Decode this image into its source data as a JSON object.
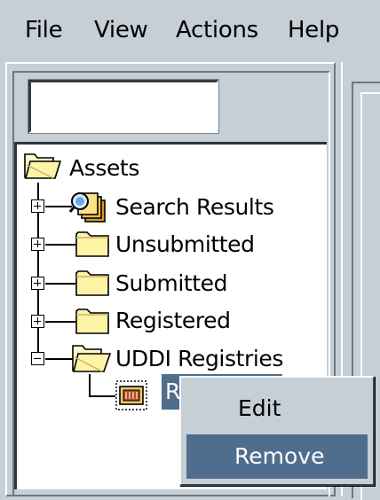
{
  "menubar": {
    "items": [
      "File",
      "View",
      "Actions",
      "Help"
    ]
  },
  "search": {
    "value": "",
    "placeholder": ""
  },
  "tree": {
    "root": {
      "label": "Assets",
      "icon": "open-folder-icon"
    },
    "children": [
      {
        "label": "Search Results",
        "icon": "search-results-icon",
        "expander": "plus"
      },
      {
        "label": "Unsubmitted",
        "icon": "folder-icon",
        "expander": "plus"
      },
      {
        "label": "Submitted",
        "icon": "folder-icon",
        "expander": "plus"
      },
      {
        "label": "Registered",
        "icon": "folder-icon",
        "expander": "plus"
      },
      {
        "label": "UDDI Registries",
        "icon": "open-folder-icon",
        "expander": "minus"
      }
    ],
    "selected_child": {
      "label": "R",
      "icon": "registry-icon"
    }
  },
  "context_menu": {
    "items": [
      {
        "label": "Edit",
        "highlighted": false
      },
      {
        "label": "Remove",
        "highlighted": true
      }
    ]
  },
  "colors": {
    "background": "#c6ced6",
    "selection": "#4f6d8d"
  }
}
